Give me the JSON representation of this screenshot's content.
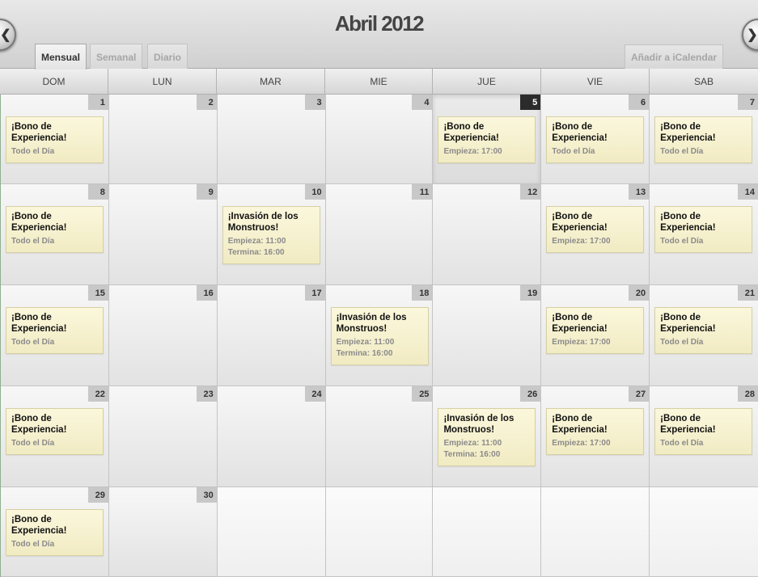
{
  "header": {
    "title": "Abril 2012",
    "prev_icon": "chevron-left-icon",
    "next_icon": "chevron-right-icon"
  },
  "tabs": [
    {
      "label": "Mensual",
      "active": true
    },
    {
      "label": "Semanal",
      "active": false
    },
    {
      "label": "Diario",
      "active": false
    }
  ],
  "icalendar_label": "Añadir a iCalendar",
  "weekdays": [
    "DOM",
    "LUN",
    "MAR",
    "MIE",
    "JUE",
    "VIE",
    "SAB"
  ],
  "today": 5,
  "weeks": [
    [
      {
        "day": 1,
        "event": {
          "title": "¡Bono de Experiencia!",
          "line1": "Todo el Día"
        }
      },
      {
        "day": 2
      },
      {
        "day": 3
      },
      {
        "day": 4
      },
      {
        "day": 5,
        "event": {
          "title": "¡Bono de Experiencia!",
          "line1": "Empieza: 17:00"
        }
      },
      {
        "day": 6,
        "event": {
          "title": "¡Bono de Experiencia!",
          "line1": "Todo el Día"
        }
      },
      {
        "day": 7,
        "event": {
          "title": "¡Bono de Experiencia!",
          "line1": "Todo el Día"
        }
      }
    ],
    [
      {
        "day": 8,
        "event": {
          "title": "¡Bono de Experiencia!",
          "line1": "Todo el Día"
        }
      },
      {
        "day": 9
      },
      {
        "day": 10,
        "event": {
          "title": "¡Invasión de los Monstruos!",
          "line1": "Empieza: 11:00",
          "line2": "Termina: 16:00"
        }
      },
      {
        "day": 11
      },
      {
        "day": 12
      },
      {
        "day": 13,
        "event": {
          "title": "¡Bono de Experiencia!",
          "line1": "Empieza: 17:00"
        }
      },
      {
        "day": 14,
        "event": {
          "title": "¡Bono de Experiencia!",
          "line1": "Todo el Día"
        }
      }
    ],
    [
      {
        "day": 15,
        "event": {
          "title": "¡Bono de Experiencia!",
          "line1": "Todo el Día"
        }
      },
      {
        "day": 16
      },
      {
        "day": 17
      },
      {
        "day": 18,
        "event": {
          "title": "¡Invasión de los Monstruos!",
          "line1": "Empieza: 11:00",
          "line2": "Termina: 16:00"
        }
      },
      {
        "day": 19
      },
      {
        "day": 20,
        "event": {
          "title": "¡Bono de Experiencia!",
          "line1": "Empieza: 17:00"
        }
      },
      {
        "day": 21,
        "event": {
          "title": "¡Bono de Experiencia!",
          "line1": "Todo el Día"
        }
      }
    ],
    [
      {
        "day": 22,
        "event": {
          "title": "¡Bono de Experiencia!",
          "line1": "Todo el Día"
        }
      },
      {
        "day": 23
      },
      {
        "day": 24
      },
      {
        "day": 25
      },
      {
        "day": 26,
        "event": {
          "title": "¡Invasión de los Monstruos!",
          "line1": "Empieza: 11:00",
          "line2": "Termina: 16:00"
        }
      },
      {
        "day": 27,
        "event": {
          "title": "¡Bono de Experiencia!",
          "line1": "Empieza: 17:00"
        }
      },
      {
        "day": 28,
        "event": {
          "title": "¡Bono de Experiencia!",
          "line1": "Todo el Día"
        }
      }
    ],
    [
      {
        "day": 29,
        "event": {
          "title": "¡Bono de Experiencia!",
          "line1": "Todo el Día"
        }
      },
      {
        "day": 30
      },
      {},
      {},
      {},
      {},
      {}
    ]
  ]
}
